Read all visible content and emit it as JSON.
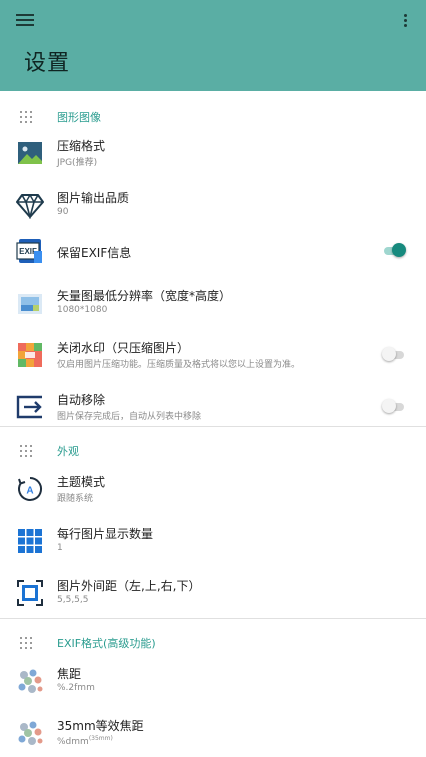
{
  "app": {
    "title": "设置",
    "bar_color": "#5aaea4",
    "accent": "#2a9c8f"
  },
  "sections": [
    {
      "label": "图形图像",
      "items": [
        {
          "title": "压缩格式",
          "subtitle": "JPG(推荐)",
          "icon": "image-icon"
        },
        {
          "title": "图片输出品质",
          "subtitle": "90",
          "icon": "diamond-icon"
        },
        {
          "title": "保留EXIF信息",
          "subtitle": "",
          "icon": "exif-icon",
          "toggle": true
        },
        {
          "title": "矢量图最低分辨率（宽度*高度）",
          "subtitle": "1080*1080",
          "icon": "vector-image-icon"
        },
        {
          "title": "关闭水印（只压缩图片）",
          "subtitle": "仅启用图片压缩功能。压缩质量及格式将以您以上设置为准。",
          "icon": "watermark-icon",
          "toggle": false
        },
        {
          "title": "自动移除",
          "subtitle": "图片保存完成后，自动从列表中移除",
          "icon": "auto-remove-icon",
          "toggle": false
        }
      ]
    },
    {
      "label": "外观",
      "items": [
        {
          "title": "主题模式",
          "subtitle": "跟随系统",
          "icon": "theme-icon"
        },
        {
          "title": "每行图片显示数量",
          "subtitle": "1",
          "icon": "grid-count-icon"
        },
        {
          "title": "图片外间距（左,上,右,下）",
          "subtitle": "5,5,5,5",
          "icon": "padding-icon"
        }
      ]
    },
    {
      "label": "EXIF格式(高级功能)",
      "items": [
        {
          "title": "焦距",
          "subtitle": "%.2fmm",
          "icon": "focal-length-icon"
        },
        {
          "title": "35mm等效焦距",
          "subtitle": "%dmm",
          "subtitle_sup": "(35mm)",
          "icon": "focal-35mm-icon"
        }
      ]
    }
  ]
}
